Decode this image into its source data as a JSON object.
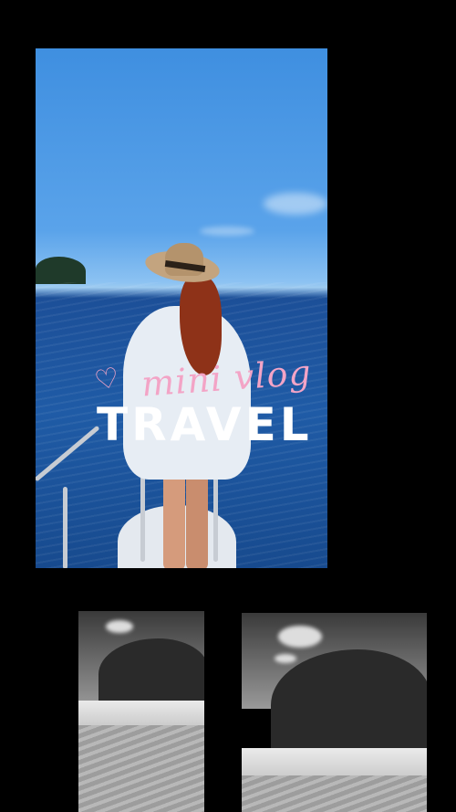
{
  "overlay": {
    "subtitle": "mini vlog",
    "heart_icon": "♡",
    "title": "TRAVEL"
  },
  "colors": {
    "background": "#000000",
    "subtitle": "#f3a4c6",
    "title": "#ffffff"
  }
}
